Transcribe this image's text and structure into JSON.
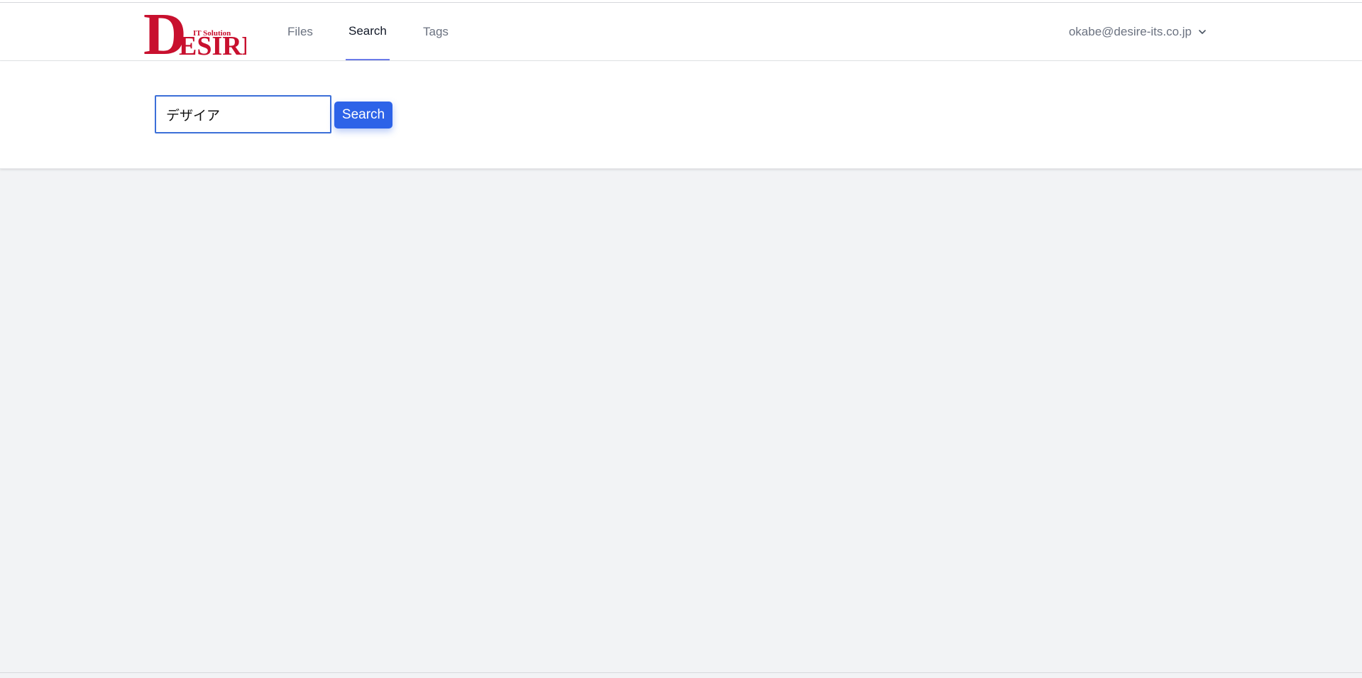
{
  "brand": {
    "logo_text_big_d": "D",
    "logo_text_esire": "ESIRE",
    "logo_text_it_solution": "IT Solution",
    "logo_color": "#c8102e"
  },
  "nav": {
    "items": [
      {
        "label": "Files",
        "active": false
      },
      {
        "label": "Search",
        "active": true
      },
      {
        "label": "Tags",
        "active": false
      }
    ],
    "active_underline_color": "#6b7bea"
  },
  "user": {
    "email": "okabe@desire-its.co.jp",
    "menu_icon": "chevron-down-icon"
  },
  "search": {
    "input_value": "デザイア",
    "button_label": "Search",
    "button_color": "#2d63e8"
  }
}
